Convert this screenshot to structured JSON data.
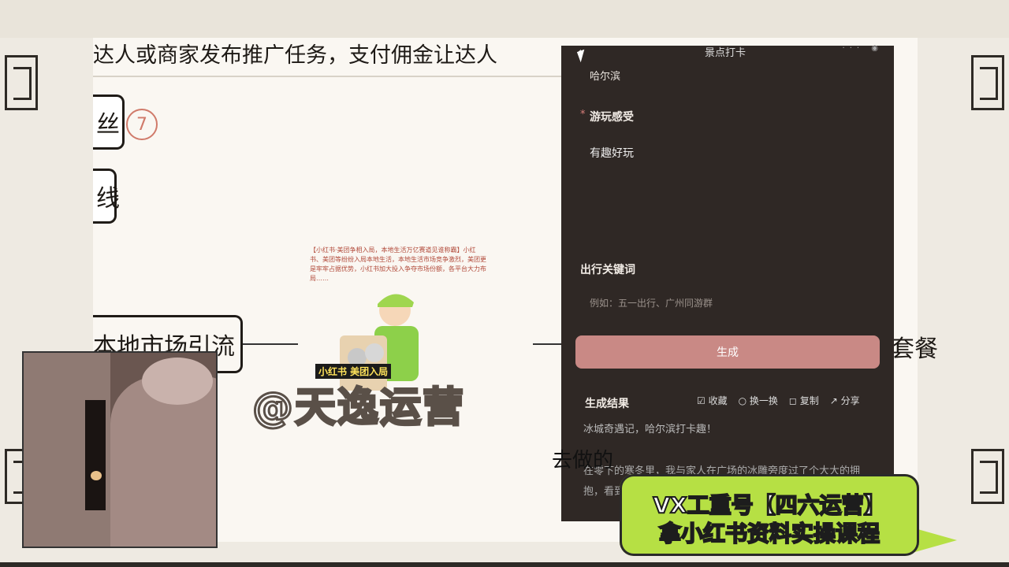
{
  "slide": {
    "top_text": "达人或商家发布推广任务，支付佣金让达人",
    "box1_text": "丝",
    "box1_num": "7",
    "box2_text": "线",
    "market_text": "本地市场引流",
    "suite_text": "套餐",
    "doing_text": "去做的"
  },
  "promo": {
    "text": "【小红书·美团争相入局，本地生活万亿赛道见谁称霸】小红书、美团等纷纷入局本地生活，本地生活市场竞争激烈，美团更是牢牢占据优势，小红书加大投入争夺市场份额，各平台大力布局……",
    "badge": "小红书 美团入局"
  },
  "watermark": "@天逸运营",
  "phone": {
    "title": "景点打卡",
    "back_icon": "chevron-left-icon",
    "field1_value": "哈尔滨",
    "field2_label": "游玩感受",
    "field2_value": "有趣好玩",
    "field3_label": "出行关键词",
    "field3_placeholder": "例如：五一出行、广州同游群",
    "generate_label": "生成",
    "result_label": "生成结果",
    "actions": [
      "收藏",
      "换一换",
      "复制",
      "分享"
    ],
    "result_title": "冰城奇遇记，哈尔滨打卡趣！",
    "result_body": "在零下的寒冬里，我与家人在广场的冰雕旁度过了个大大的拥抱，看到无数雕刻精美的作品……"
  },
  "banner": {
    "line1": "VX工重号【四六运营】",
    "line2": "拿小红书资料实操课程"
  }
}
